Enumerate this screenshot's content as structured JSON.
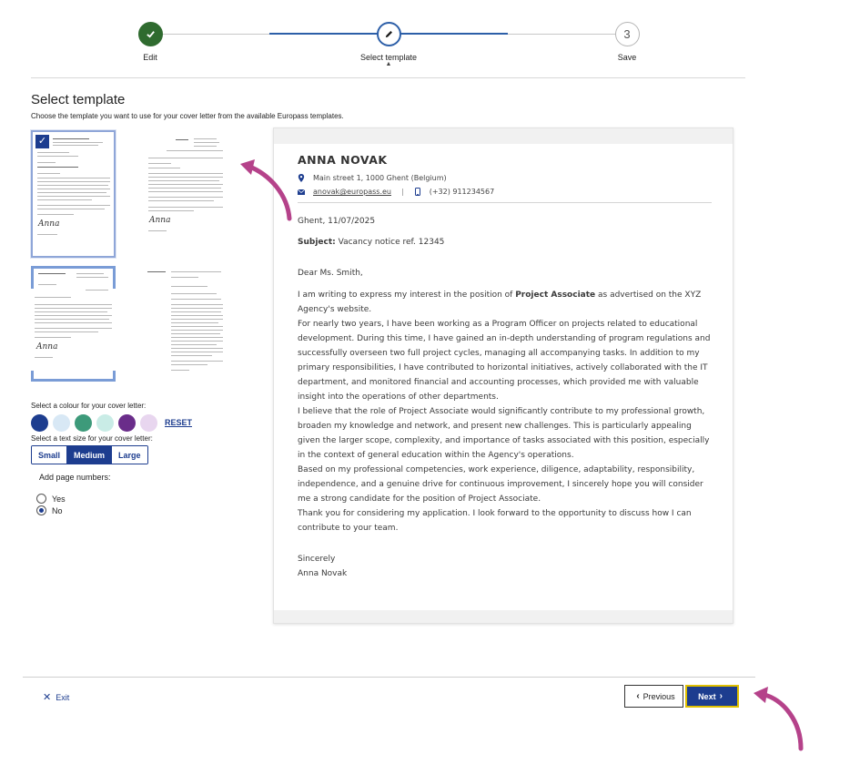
{
  "stepper": {
    "steps": [
      {
        "label": "Edit",
        "state": "done",
        "icon": "check-icon"
      },
      {
        "label": "Select template",
        "state": "current",
        "icon": "pencil-icon"
      },
      {
        "label": "Save",
        "state": "todo",
        "number": "3"
      }
    ]
  },
  "header": {
    "title": "Select template",
    "subtitle": "Choose the template you want to use for your cover letter from the available Europass templates."
  },
  "templates": {
    "selected_index": 0,
    "signature_text": "Anna"
  },
  "options": {
    "colour_label": "Select a colour for your cover letter:",
    "colours": [
      "#1d3d8f",
      "#d8e8f5",
      "#3d9a7a",
      "#c9ece6",
      "#6a2d8a",
      "#e8d6ef"
    ],
    "reset_label": "RESET",
    "size_label": "Select a text size for your cover letter:",
    "sizes": [
      "Small",
      "Medium",
      "Large"
    ],
    "selected_size": "Medium",
    "page_numbers_label": "Add page numbers:",
    "page_numbers_options": [
      "Yes",
      "No"
    ],
    "page_numbers_selected": "No"
  },
  "letter": {
    "name": "ANNA NOVAK",
    "address": "Main street 1, 1000 Ghent (Belgium)",
    "email": "anovak@europass.eu",
    "phone": "(+32) 911234567",
    "place_date": "Ghent, 11/07/2025",
    "subject_label": "Subject:",
    "subject_text": "Vacancy notice ref. 12345",
    "salutation": "Dear Ms. Smith,",
    "p1_before": "I am writing to express my interest in the position of ",
    "p1_bold": "Project Associate",
    "p1_after": " as advertised on the XYZ Agency's website.",
    "p2": "For nearly two years, I have been working as a Program Officer on projects related to educational development. During this time, I have gained an in-depth understanding of program regulations and successfully overseen two full project cycles, managing all accompanying tasks. In addition to my primary responsibilities, I have contributed to horizontal initiatives, actively collaborated with the IT department, and monitored financial and accounting processes, which provided me with valuable insight into the operations of other departments.",
    "p3": "I believe that the role of Project Associate would significantly contribute to my professional growth, broaden my knowledge and network, and present new challenges. This is particularly appealing given the larger scope, complexity, and importance of tasks associated with this position, especially in the context of general education within the Agency's operations.",
    "p4": "Based on my professional competencies, work experience, diligence, adaptability, responsibility, independence, and a genuine drive for continuous improvement, I sincerely hope you will consider me a strong candidate for the position of Project Associate.",
    "p5": "Thank you for considering my application. I look forward to the opportunity to discuss how I can contribute to your team.",
    "closing": "Sincerely",
    "signature": "Anna Novak"
  },
  "footer": {
    "exit_label": "Exit",
    "previous_label": "Previous",
    "next_label": "Next"
  },
  "colors": {
    "primary": "#1d3d8f",
    "accent_arrow": "#b5428a",
    "done_green": "#2f6b2f"
  }
}
